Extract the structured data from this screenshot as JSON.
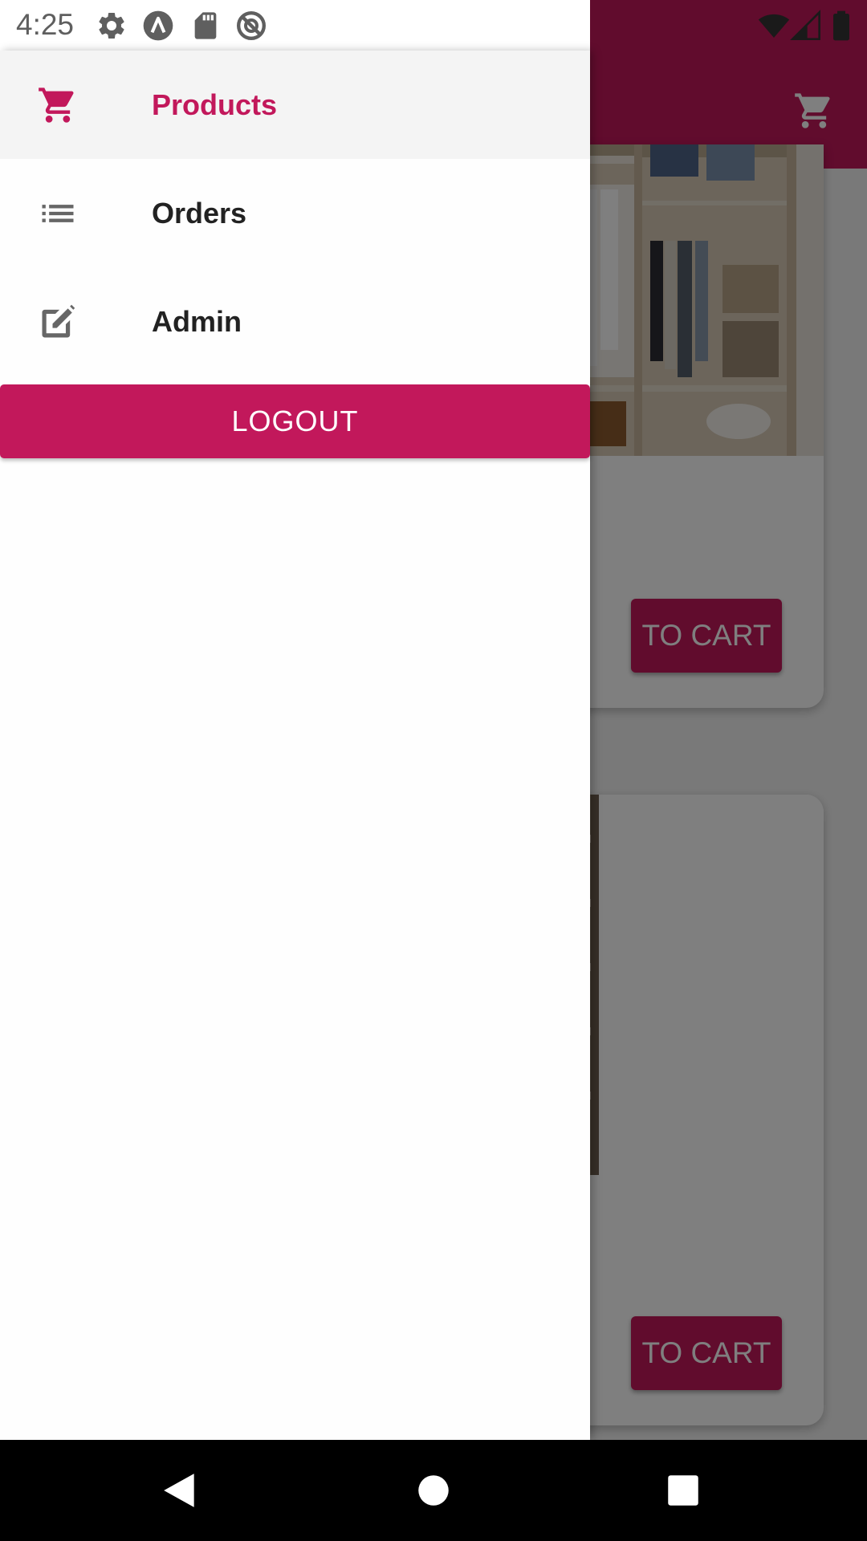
{
  "status_bar": {
    "time": "4:25",
    "left_icons": [
      "settings-icon",
      "android-auto-icon",
      "sd-card-icon",
      "do-not-disturb-icon"
    ],
    "right_icons": [
      "wifi-icon",
      "cell-signal-icon",
      "battery-icon"
    ]
  },
  "drawer": {
    "items": [
      {
        "label": "Products",
        "icon": "cart-icon",
        "active": true
      },
      {
        "label": "Orders",
        "icon": "list-icon",
        "active": false
      },
      {
        "label": "Admin",
        "icon": "edit-icon",
        "active": false
      }
    ],
    "logout_label": "LOGOUT"
  },
  "background": {
    "app_bar_icon": "cart-icon",
    "products": [
      {
        "button_label": "TO CART"
      },
      {
        "button_label": "TO CART"
      }
    ]
  },
  "nav_bar": {
    "buttons": [
      "back-icon",
      "home-icon",
      "recents-icon"
    ]
  },
  "colors": {
    "accent": "#c2185b",
    "scrim": "rgba(0,0,0,0.5)"
  }
}
